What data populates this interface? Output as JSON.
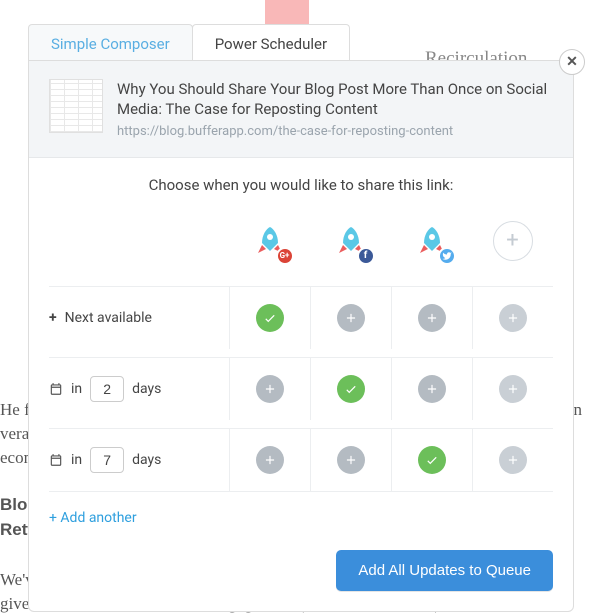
{
  "tabs": {
    "simple": "Simple Composer",
    "power": "Power Scheduler"
  },
  "close_glyph": "✕",
  "header": {
    "title": "Why You Should Share Your Blog Post More Than Once on Social Media: The Case for Reposting Content",
    "url": "https://blog.bufferapp.com/the-case-for-reposting-content"
  },
  "prompt": "Choose when you would like to share this link:",
  "profiles": [
    {
      "network": "googleplus",
      "badge_class": "badge-g",
      "badge_glyph": "G+"
    },
    {
      "network": "facebook",
      "badge_class": "badge-f",
      "badge_glyph": "f"
    },
    {
      "network": "twitter",
      "badge_class": "badge-t",
      "badge_glyph": ""
    }
  ],
  "add_profile_glyph": "+",
  "rows": [
    {
      "kind": "next",
      "plus_glyph": "+",
      "label": "Next available",
      "slots": [
        true,
        false,
        false,
        false
      ]
    },
    {
      "kind": "days",
      "prefix": "in",
      "value": "2",
      "suffix": "days",
      "slots": [
        false,
        true,
        false,
        false
      ]
    },
    {
      "kind": "days",
      "prefix": "in",
      "value": "7",
      "suffix": "days",
      "slots": [
        false,
        false,
        true,
        false
      ]
    }
  ],
  "add_another": "+ Add another",
  "cta": "Add All Updates to Queue",
  "bg": {
    "recirc": "Recirculation",
    "line_a1": "He fo",
    "line_a2": "on",
    "line_b": "vera",
    "line_c": "econ",
    "line_d": "Blog",
    "line_e": "Retw",
    "line_f": "We've also noticed that Tweeting posts from the Buffer blog more than once",
    "line_g": "gives us more traffic and more engagement (favorites, Retweets)."
  }
}
